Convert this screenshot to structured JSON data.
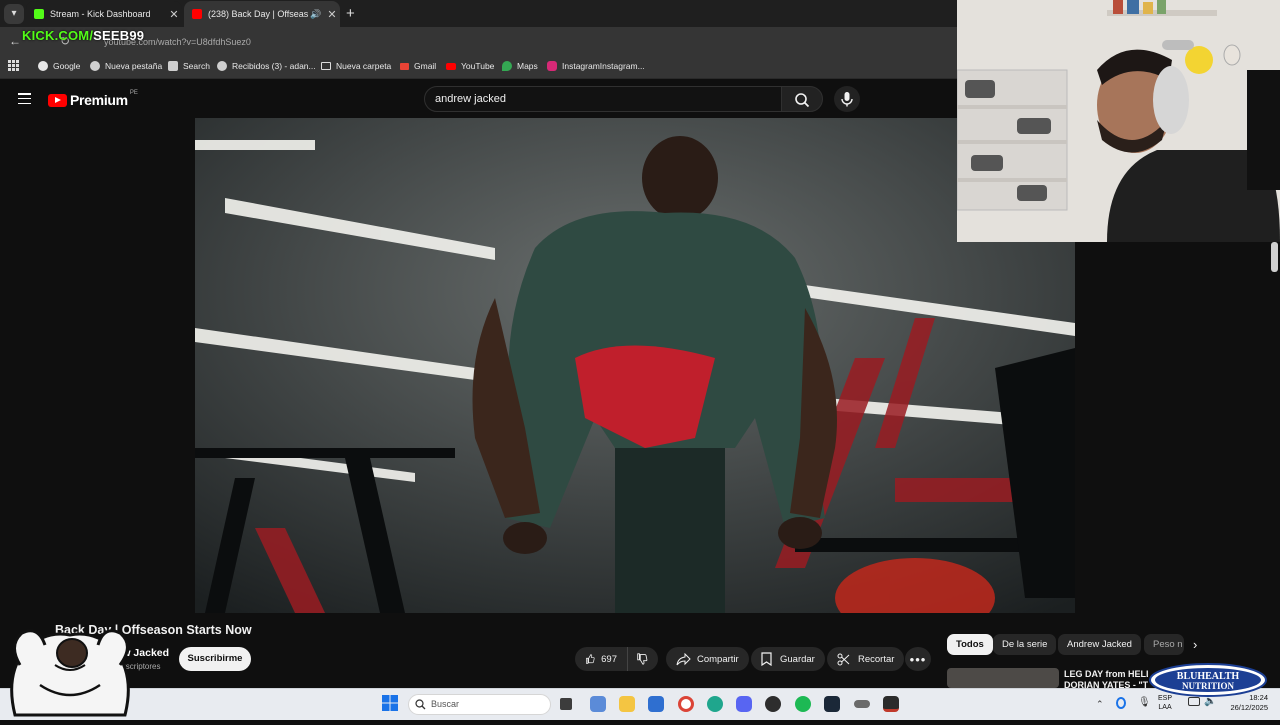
{
  "browser": {
    "tabs": [
      {
        "title": "Stream - Kick Dashboard",
        "icon": "kick-icon",
        "active": false
      },
      {
        "title": "(238) Back Day | Offseason",
        "icon": "youtube-icon",
        "active": true
      }
    ],
    "url": "youtube.com/watch?v=U8dfdhSuez0",
    "bookmarks": [
      {
        "label": "Google",
        "icon": "google-icon"
      },
      {
        "label": "Nueva pestaña",
        "icon": "globe-icon"
      },
      {
        "label": "Search",
        "icon": "search-icon"
      },
      {
        "label": "Recibidos (3) - adan...",
        "icon": "globe-icon"
      },
      {
        "label": "Nueva carpeta",
        "icon": "folder-icon"
      },
      {
        "label": "Gmail",
        "icon": "gmail-icon"
      },
      {
        "label": "YouTube",
        "icon": "youtube-icon"
      },
      {
        "label": "Maps",
        "icon": "maps-icon"
      },
      {
        "label": "InstagramInstagram...",
        "icon": "instagram-icon"
      }
    ]
  },
  "stream_overlay": {
    "prefix": "KICK.COM/",
    "channel": "SEEB99"
  },
  "youtube": {
    "logo": "Premium",
    "country": "PE",
    "search_query": "andrew jacked",
    "video": {
      "title": "Back Day | Offseason Starts Now",
      "channel": "Andrew Jacked",
      "subscribers": "1,70 K suscriptores",
      "subscribe_label": "Suscribirme",
      "likes": "697",
      "share_label": "Compartir",
      "save_label": "Guardar",
      "clip_label": "Recortar"
    },
    "chips": [
      "Todos",
      "De la serie",
      "Andrew Jacked",
      "Peso n"
    ],
    "recommended": {
      "title_line1": "LEG DAY from HELL",
      "title_line2": "DORIAN YATES - \"TR"
    }
  },
  "sponsor": {
    "line1": "BLUHEALTH",
    "line2": "NUTRITION"
  },
  "taskbar": {
    "search_placeholder": "Buscar",
    "lang_line1": "ESP",
    "lang_line2": "LAA",
    "time": "18:24",
    "date": "26/12/2025"
  },
  "colors": {
    "youtube_red": "#ff0000",
    "kick_green": "#53fc18",
    "dark_bg": "#0f0f0f"
  }
}
